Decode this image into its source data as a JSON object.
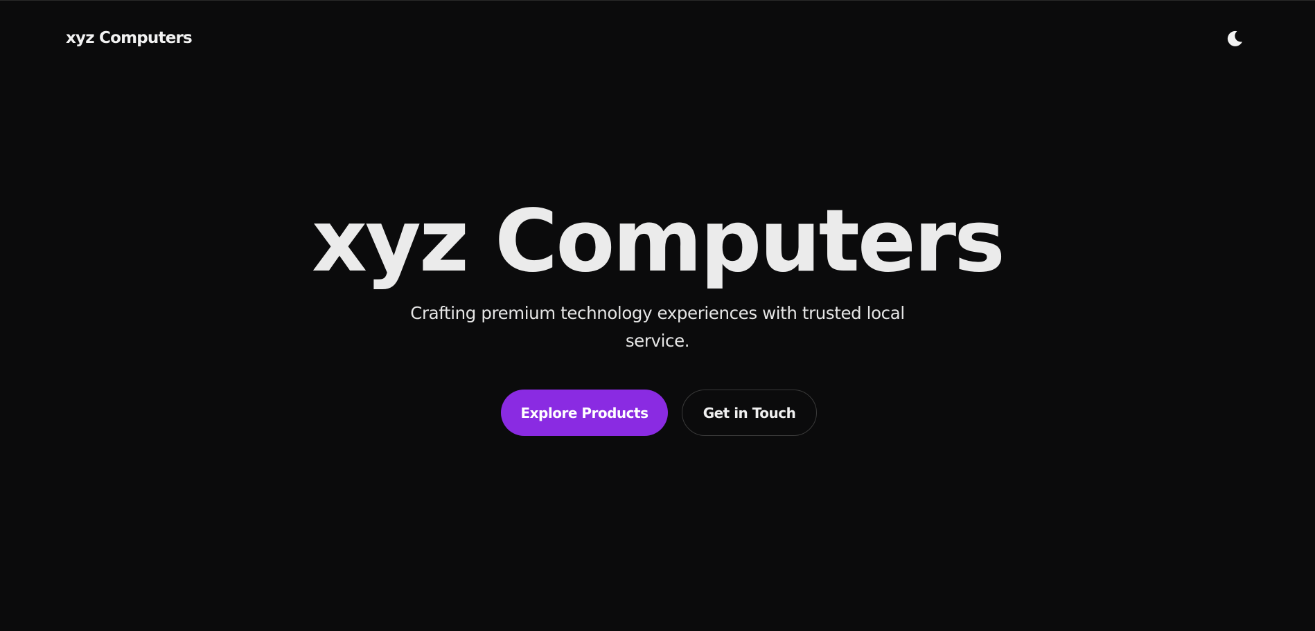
{
  "header": {
    "logo_text": "xyz Computers",
    "theme_toggle_icon": "moon-icon"
  },
  "hero": {
    "title": "xyz Computers",
    "subtitle": "Crafting premium technology experiences with trusted local service."
  },
  "actions": {
    "primary_label": "Explore Products",
    "secondary_label": "Get in Touch"
  },
  "colors": {
    "background": "#0b0b0c",
    "accent": "#8a2be2",
    "text": "#ececec",
    "button_border": "#3a3a3a"
  }
}
